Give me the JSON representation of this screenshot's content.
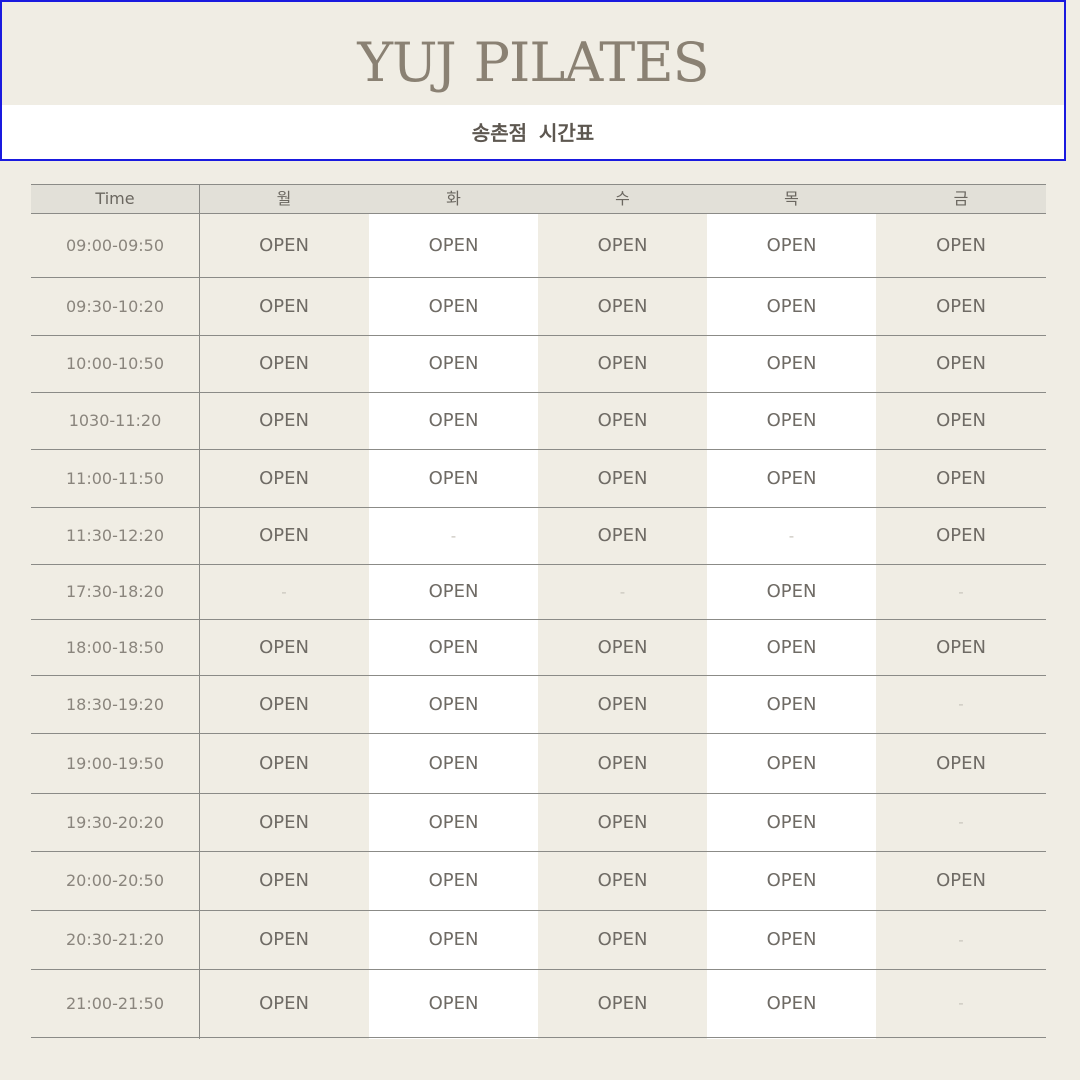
{
  "header": {
    "brand_part1": "YUJ",
    "brand_part2": "PILATES",
    "branch": "송촌점",
    "subtitle": "시간표"
  },
  "table": {
    "columns": [
      "Time",
      "월",
      "화",
      "수",
      "목",
      "금"
    ],
    "rows": [
      {
        "time": "09:00-09:50",
        "cells": [
          "OPEN",
          "OPEN",
          "OPEN",
          "OPEN",
          "OPEN"
        ]
      },
      {
        "time": "09:30-10:20",
        "cells": [
          "OPEN",
          "OPEN",
          "OPEN",
          "OPEN",
          "OPEN"
        ]
      },
      {
        "time": "10:00-10:50",
        "cells": [
          "OPEN",
          "OPEN",
          "OPEN",
          "OPEN",
          "OPEN"
        ]
      },
      {
        "time": "1030-11:20",
        "cells": [
          "OPEN",
          "OPEN",
          "OPEN",
          "OPEN",
          "OPEN"
        ]
      },
      {
        "time": "11:00-11:50",
        "cells": [
          "OPEN",
          "OPEN",
          "OPEN",
          "OPEN",
          "OPEN"
        ]
      },
      {
        "time": "11:30-12:20",
        "cells": [
          "OPEN",
          "-",
          "OPEN",
          "-",
          "OPEN"
        ]
      },
      {
        "time": "17:30-18:20",
        "cells": [
          "-",
          "OPEN",
          "-",
          "OPEN",
          "-"
        ]
      },
      {
        "time": "18:00-18:50",
        "cells": [
          "OPEN",
          "OPEN",
          "OPEN",
          "OPEN",
          "OPEN"
        ]
      },
      {
        "time": "18:30-19:20",
        "cells": [
          "OPEN",
          "OPEN",
          "OPEN",
          "OPEN",
          "-"
        ]
      },
      {
        "time": "19:00-19:50",
        "cells": [
          "OPEN",
          "OPEN",
          "OPEN",
          "OPEN",
          "OPEN"
        ]
      },
      {
        "time": "19:30-20:20",
        "cells": [
          "OPEN",
          "OPEN",
          "OPEN",
          "OPEN",
          "-"
        ]
      },
      {
        "time": "20:00-20:50",
        "cells": [
          "OPEN",
          "OPEN",
          "OPEN",
          "OPEN",
          "OPEN"
        ]
      },
      {
        "time": "20:30-21:20",
        "cells": [
          "OPEN",
          "OPEN",
          "OPEN",
          "OPEN",
          "-"
        ]
      },
      {
        "time": "21:00-21:50",
        "cells": [
          "OPEN",
          "OPEN",
          "OPEN",
          "OPEN",
          "-"
        ]
      }
    ]
  },
  "colors": {
    "page_bg": "#f0ede4",
    "header_border": "#1a1adf",
    "brand_text": "#8a8173",
    "header_row_bg": "#e2e0d8",
    "white_column": "#ffffff"
  }
}
